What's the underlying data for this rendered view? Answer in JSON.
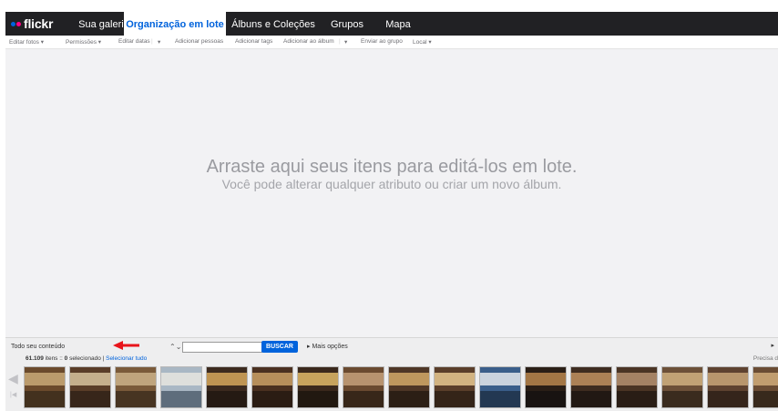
{
  "header": {
    "logo_text": "flickr",
    "nav": [
      {
        "label": "Sua galeria",
        "active": false
      },
      {
        "label": "Organização em lote",
        "active": true
      },
      {
        "label": "Álbuns e Coleções",
        "active": false
      },
      {
        "label": "Grupos",
        "active": false
      },
      {
        "label": "Mapa",
        "active": false
      }
    ]
  },
  "toolbar": {
    "items": [
      "Editar fotos",
      "Permissões",
      "Editar datas",
      "Adicionar pessoas",
      "Adicionar tags",
      "Adicionar ao álbum",
      "Enviar ao grupo",
      "Local"
    ]
  },
  "dropzone": {
    "main_text": "Arraste aqui seus itens para editá-los em lote.",
    "sub_text": "Você pode alterar qualquer atributo ou criar um novo álbum."
  },
  "bottom": {
    "scope_select": "Todo seu conteúdo",
    "search_value": "",
    "search_button": "BUSCAR",
    "more_options": "Mais opções",
    "item_count": "61.109",
    "items_text": "itens ::",
    "selected_count": "0",
    "selected_text": "selecionado |",
    "select_all": "Selecionar tudo",
    "help_text": "Precisa d"
  },
  "thumbnails_count": 17,
  "colors": {
    "brand_blue": "#0063dc",
    "brand_pink": "#ff0084",
    "topbar": "#212124"
  }
}
